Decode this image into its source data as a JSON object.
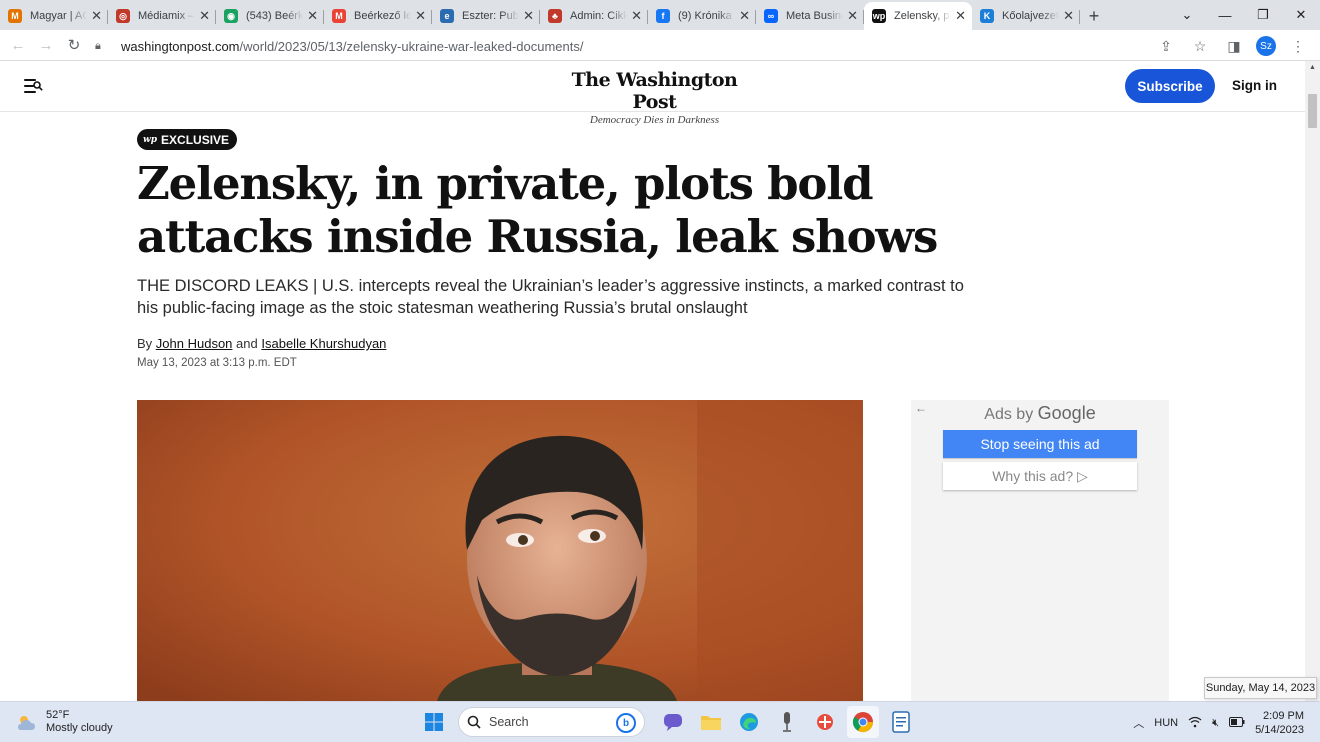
{
  "browser": {
    "tabs": [
      {
        "label": "Magyar | AC",
        "fav_color": "#e37400",
        "fav_glyph": "M"
      },
      {
        "label": "Médiamix –",
        "fav_color": "#c0392b",
        "fav_glyph": "◎"
      },
      {
        "label": "(543) Beérk",
        "fav_color": "#1aa260",
        "fav_glyph": "◉"
      },
      {
        "label": "Beérkező le",
        "fav_color": "#ea4335",
        "fav_glyph": "M"
      },
      {
        "label": "Eszter: Publ",
        "fav_color": "#2b6cb0",
        "fav_glyph": "e"
      },
      {
        "label": "Admin: Cikk",
        "fav_color": "#c0392b",
        "fav_glyph": "♣"
      },
      {
        "label": "(9) Krónika",
        "fav_color": "#1877f2",
        "fav_glyph": "f"
      },
      {
        "label": "Meta Busine",
        "fav_color": "#0866ff",
        "fav_glyph": "∞"
      },
      {
        "label": "Zelensky, pl",
        "fav_color": "#111111",
        "fav_glyph": "wp"
      },
      {
        "label": "Kőolajvezet",
        "fav_color": "#1c7ed6",
        "fav_glyph": "K"
      }
    ],
    "url_host": "washingtonpost.com",
    "url_path": "/world/2023/05/13/zelensky-ukraine-war-leaked-documents/",
    "profile_initials": "Sz"
  },
  "header": {
    "logo_name": "The Washington Post",
    "logo_tagline": "Democracy Dies in Darkness",
    "subscribe_label": "Subscribe",
    "signin_label": "Sign in"
  },
  "article": {
    "badge_mark": "wp",
    "badge_label": "EXCLUSIVE",
    "headline": "Zelensky, in private, plots bold attacks inside Russia, leak shows",
    "dek": "THE DISCORD LEAKS | U.S. intercepts reveal the Ukrainian’s leader’s aggressive instincts, a marked contrast to his public-facing image as the stoic statesman weathering Russia’s brutal onslaught",
    "byline_prefix": "By",
    "author1": "John Hudson",
    "byline_and": "and",
    "author2": "Isabelle Khurshudyan",
    "dateline": "May 13, 2023 at 3:13 p.m. EDT"
  },
  "ad": {
    "ads_by": "Ads by",
    "google": "Google",
    "stop_label": "Stop seeing this ad",
    "why_label": "Why this ad? ▷"
  },
  "taskbar": {
    "temp": "52°F",
    "condition": "Mostly cloudy",
    "search_label": "Search",
    "lang": "HUN",
    "time": "2:09 PM",
    "date": "5/14/2023",
    "tooltip": "Sunday, May 14, 2023"
  },
  "colors": {
    "subscribe_bg": "#1955d8",
    "ad_button": "#4285f4",
    "photo_bg": "#b35a2a"
  }
}
